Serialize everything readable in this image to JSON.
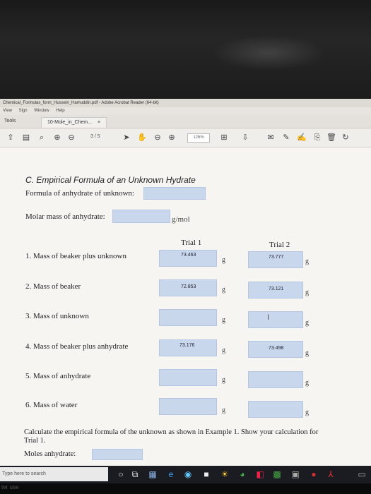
{
  "window": {
    "title": "Chemical_Formulas_form_Hussein_Hamuddin.pdf - Adobe Acrobat Reader (64-bit)",
    "menu": [
      "View",
      "Sign",
      "Window",
      "Help"
    ]
  },
  "tabs": {
    "tools": "Tools",
    "doc": "10-Mole_in_Chem...",
    "close": "×"
  },
  "toolbar": {
    "page": "3 / 5",
    "zoom": "126%"
  },
  "form": {
    "section_title": "C. Empirical Formula of an Unknown Hydrate",
    "formula_label": "Formula of anhydrate of unknown:",
    "molar_label": "Molar mass of anhydrate:",
    "molar_unit": "g/mol",
    "trial1": "Trial 1",
    "trial2": "Trial 2",
    "unit": "g",
    "rows": [
      {
        "label": "1.  Mass of beaker plus unknown",
        "t1": "73.463",
        "t2": "73.777"
      },
      {
        "label": "2.  Mass of beaker",
        "t1": "72.853",
        "t2": "73.121"
      },
      {
        "label": "3.  Mass of unknown",
        "t1": "",
        "t2": ""
      },
      {
        "label": "4.  Mass of beaker plus anhydrate",
        "t1": "73.176",
        "t2": "73.498"
      },
      {
        "label": "5.  Mass of anhydrate",
        "t1": "",
        "t2": ""
      },
      {
        "label": "6.  Mass of water",
        "t1": "",
        "t2": ""
      }
    ],
    "calc_line1": "Calculate the empirical formula of the unknown as shown in Example 1. Show your calculation for",
    "calc_line2": "Trial 1.",
    "moles_label": "Moles anhydrate:"
  },
  "taskbar": {
    "search_placeholder": "Type here to search"
  },
  "bottom": {
    "label": "ter use"
  },
  "colors": {
    "field_fill": "#c9d7ec",
    "taskbar": "#1b1b22"
  }
}
